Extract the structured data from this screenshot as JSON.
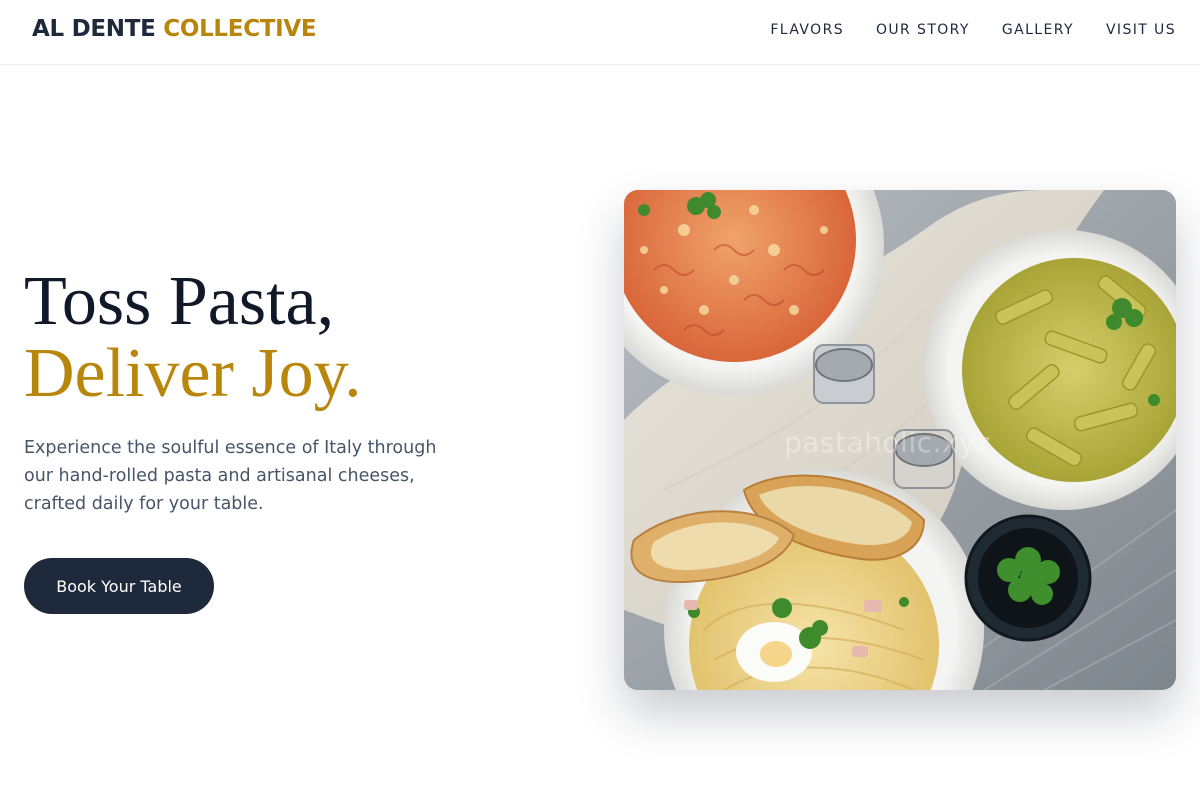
{
  "brand": {
    "part1": "AL DENTE",
    "part2": "COLLECTIVE"
  },
  "nav": {
    "items": [
      {
        "label": "FLAVORS"
      },
      {
        "label": "OUR STORY"
      },
      {
        "label": "GALLERY"
      },
      {
        "label": "VISIT US"
      }
    ]
  },
  "hero": {
    "title_line1": "Toss Pasta,",
    "title_line2": "Deliver Joy.",
    "subtitle": "Experience the soulful essence of Italy through our hand-rolled pasta and artisanal cheeses, crafted daily for your table.",
    "cta_label": "Book Your Table",
    "image_watermark": "pastaholic.xyz"
  },
  "colors": {
    "navy": "#1e293b",
    "gold": "#b8860b",
    "body_text": "#475569"
  }
}
